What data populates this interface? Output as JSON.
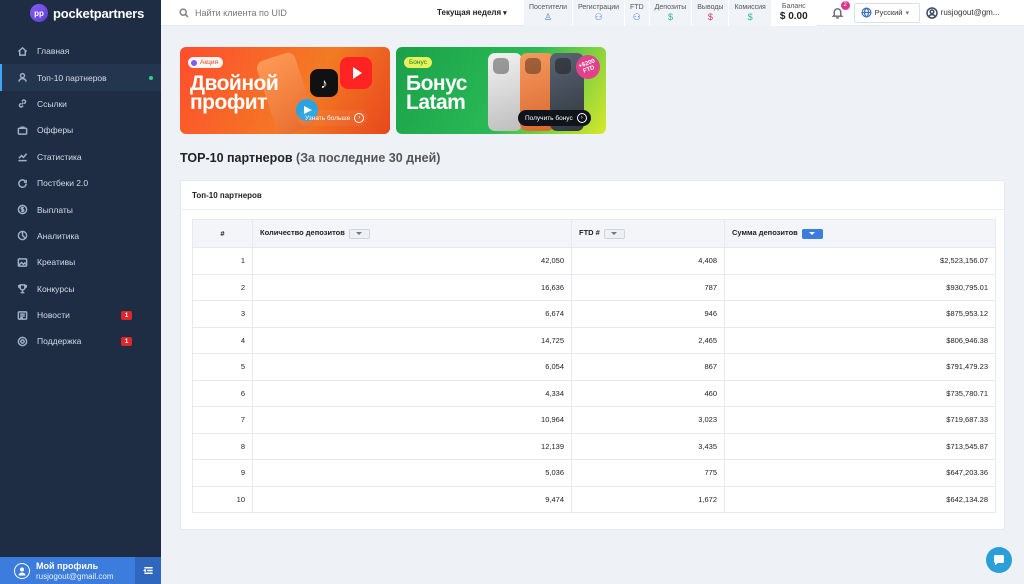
{
  "brand": {
    "name": "pocketpartners",
    "mark": "pp"
  },
  "sidebar": {
    "items": [
      {
        "label": "Главная",
        "icon": "home-icon"
      },
      {
        "label": "Топ-10 партнеров",
        "icon": "user-icon",
        "active": true
      },
      {
        "label": "Ссылки",
        "icon": "link-icon"
      },
      {
        "label": "Офферы",
        "icon": "briefcase-icon"
      },
      {
        "label": "Статистика",
        "icon": "chart-icon"
      },
      {
        "label": "Постбеки 2.0",
        "icon": "postback-icon"
      },
      {
        "label": "Выплаты",
        "icon": "dollar-icon"
      },
      {
        "label": "Аналитика",
        "icon": "analytics-icon"
      },
      {
        "label": "Креативы",
        "icon": "image-icon"
      },
      {
        "label": "Конкурсы",
        "icon": "trophy-icon"
      },
      {
        "label": "Новости",
        "icon": "news-icon",
        "badge": "1"
      },
      {
        "label": "Поддержка",
        "icon": "support-icon",
        "badge": "1"
      }
    ],
    "profile": {
      "name": "Мой профиль",
      "email": "rusjogout@gmail.com"
    }
  },
  "topbar": {
    "search_placeholder": "Найти клиента по UID",
    "period": "Текущая неделя",
    "stats": [
      {
        "label": "Посетители",
        "icon": "visitor-icon"
      },
      {
        "label": "Регистрации",
        "icon": "users-icon"
      },
      {
        "label": "FTD",
        "icon": "ftd-icon"
      },
      {
        "label": "Депозиты",
        "icon": "$"
      },
      {
        "label": "Выводы",
        "icon": "$"
      },
      {
        "label": "Комиссия",
        "icon": "$"
      }
    ],
    "balance_label": "Баланс",
    "balance_value": "$ 0.00",
    "notifications": "2",
    "language": "Русский",
    "user": "rusjogout@gm..."
  },
  "banners": [
    {
      "tag": "Акция",
      "title_line1": "Двойной",
      "title_line2": "профит",
      "button": "Узнать больше"
    },
    {
      "tag": "Бонус",
      "title_line1": "Бонус",
      "title_line2": "Latam",
      "button": "Получить бонус",
      "sticker": "+$200 FTD"
    }
  ],
  "page": {
    "title": "TOP-10 партнеров",
    "subtitle": "(За последние 30 дней)"
  },
  "table": {
    "card_title": "Топ-10 партнеров",
    "headers": {
      "rank": "#",
      "deposits": "Количество депозитов",
      "ftd": "FTD #",
      "sum": "Сумма депозитов"
    },
    "rows": [
      {
        "rank": "1",
        "deposits": "42,050",
        "ftd": "4,408",
        "sum": "$2,523,156.07"
      },
      {
        "rank": "2",
        "deposits": "16,636",
        "ftd": "787",
        "sum": "$930,795.01"
      },
      {
        "rank": "3",
        "deposits": "6,674",
        "ftd": "946",
        "sum": "$875,953.12"
      },
      {
        "rank": "4",
        "deposits": "14,725",
        "ftd": "2,465",
        "sum": "$806,946.38"
      },
      {
        "rank": "5",
        "deposits": "6,054",
        "ftd": "867",
        "sum": "$791,479.23"
      },
      {
        "rank": "6",
        "deposits": "4,334",
        "ftd": "460",
        "sum": "$735,780.71"
      },
      {
        "rank": "7",
        "deposits": "10,964",
        "ftd": "3,023",
        "sum": "$719,687.33"
      },
      {
        "rank": "8",
        "deposits": "12,139",
        "ftd": "3,435",
        "sum": "$713,545.87"
      },
      {
        "rank": "9",
        "deposits": "5,036",
        "ftd": "775",
        "sum": "$647,203.36"
      },
      {
        "rank": "10",
        "deposits": "9,474",
        "ftd": "1,672",
        "sum": "$642,134.28"
      }
    ]
  },
  "colors": {
    "sidebar": "#1e2d44",
    "accent": "#3b7cdc",
    "badge": "#e0262b",
    "positive": "#2bb59b",
    "negative": "#e0334f"
  }
}
